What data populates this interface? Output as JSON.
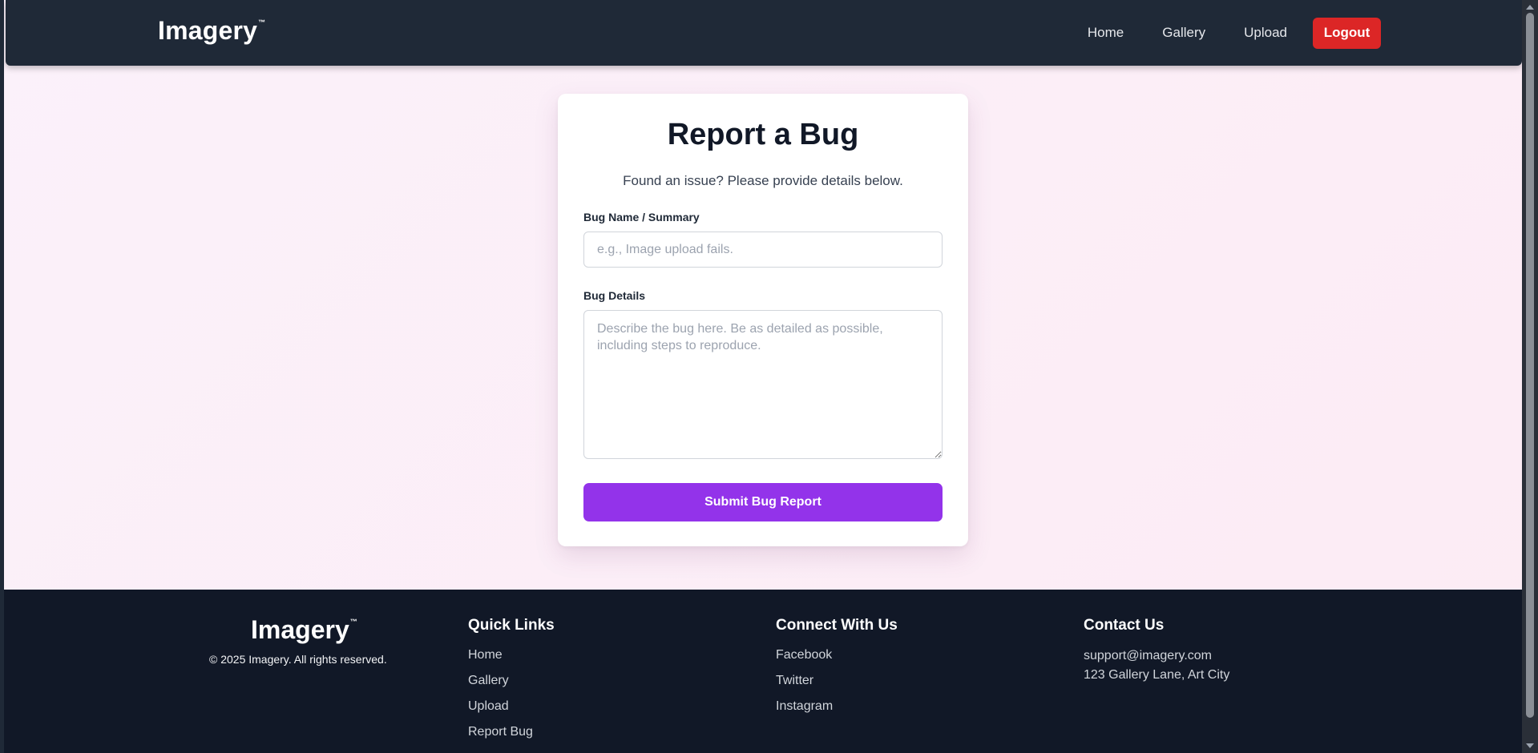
{
  "header": {
    "brand": "Imagery",
    "trademark": "™",
    "nav": [
      "Home",
      "Gallery",
      "Upload"
    ],
    "logout_label": "Logout"
  },
  "form": {
    "title": "Report a Bug",
    "subtitle": "Found an issue? Please provide details below.",
    "name_label": "Bug Name / Summary",
    "name_placeholder": "e.g., Image upload fails.",
    "details_label": "Bug Details",
    "details_placeholder": "Describe the bug here. Be as detailed as possible, including steps to reproduce.",
    "submit_label": "Submit Bug Report"
  },
  "footer": {
    "brand": "Imagery",
    "trademark": "™",
    "copyright": "© 2025 Imagery. All rights reserved.",
    "quick_links": {
      "heading": "Quick Links",
      "items": [
        "Home",
        "Gallery",
        "Upload",
        "Report Bug"
      ]
    },
    "connect": {
      "heading": "Connect With Us",
      "items": [
        "Facebook",
        "Twitter",
        "Instagram"
      ]
    },
    "contact": {
      "heading": "Contact Us",
      "email": "support@imagery.com",
      "address": "123 Gallery Lane, Art City"
    }
  },
  "colors": {
    "nav_bg": "#1f2937",
    "logout": "#dc2626",
    "submit": "#9333ea",
    "footer_bg": "#111827"
  }
}
